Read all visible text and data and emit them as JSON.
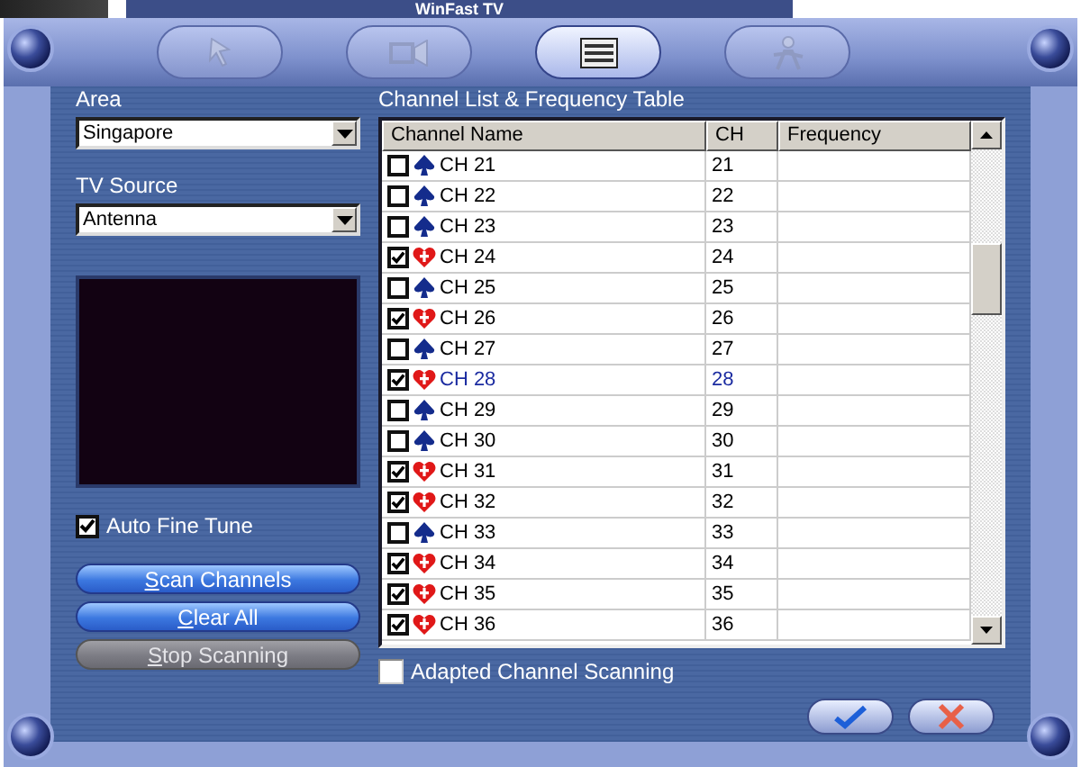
{
  "background_window": {
    "title": "WinFast TV"
  },
  "tabs": [
    {
      "kind": "remote",
      "selected": false
    },
    {
      "kind": "video",
      "selected": false
    },
    {
      "kind": "channels",
      "selected": true
    },
    {
      "kind": "settings",
      "selected": false
    }
  ],
  "area": {
    "label": "Area",
    "value": "Singapore"
  },
  "tv_source": {
    "label": "TV Source",
    "value": "Antenna"
  },
  "auto_fine_tune": {
    "label": "Auto Fine Tune",
    "checked": true
  },
  "buttons": [
    {
      "label": "Scan Channels",
      "disabled": false
    },
    {
      "label": "Clear All",
      "disabled": false
    },
    {
      "label": "Stop Scanning",
      "disabled": true
    }
  ],
  "channel_table": {
    "title": "Channel List & Frequency Table",
    "columns": [
      "Channel Name",
      "CH",
      "Frequency"
    ],
    "rows": [
      {
        "name": "CH 21",
        "ch": "21",
        "checked": false,
        "selected": false
      },
      {
        "name": "CH 22",
        "ch": "22",
        "checked": false,
        "selected": false
      },
      {
        "name": "CH 23",
        "ch": "23",
        "checked": false,
        "selected": false
      },
      {
        "name": "CH 24",
        "ch": "24",
        "checked": true,
        "selected": false
      },
      {
        "name": "CH 25",
        "ch": "25",
        "checked": false,
        "selected": false
      },
      {
        "name": "CH 26",
        "ch": "26",
        "checked": true,
        "selected": false
      },
      {
        "name": "CH 27",
        "ch": "27",
        "checked": false,
        "selected": false
      },
      {
        "name": "CH 28",
        "ch": "28",
        "checked": true,
        "selected": true
      },
      {
        "name": "CH 29",
        "ch": "29",
        "checked": false,
        "selected": false
      },
      {
        "name": "CH 30",
        "ch": "30",
        "checked": false,
        "selected": false
      },
      {
        "name": "CH 31",
        "ch": "31",
        "checked": true,
        "selected": false
      },
      {
        "name": "CH 32",
        "ch": "32",
        "checked": true,
        "selected": false
      },
      {
        "name": "CH 33",
        "ch": "33",
        "checked": false,
        "selected": false
      },
      {
        "name": "CH 34",
        "ch": "34",
        "checked": true,
        "selected": false
      },
      {
        "name": "CH 35",
        "ch": "35",
        "checked": true,
        "selected": false
      },
      {
        "name": "CH 36",
        "ch": "36",
        "checked": true,
        "selected": false
      }
    ]
  },
  "adapted_scanning": {
    "label": "Adapted Channel Scanning",
    "checked": false
  },
  "dialog_buttons": [
    {
      "kind": "ok"
    },
    {
      "kind": "cancel"
    }
  ]
}
